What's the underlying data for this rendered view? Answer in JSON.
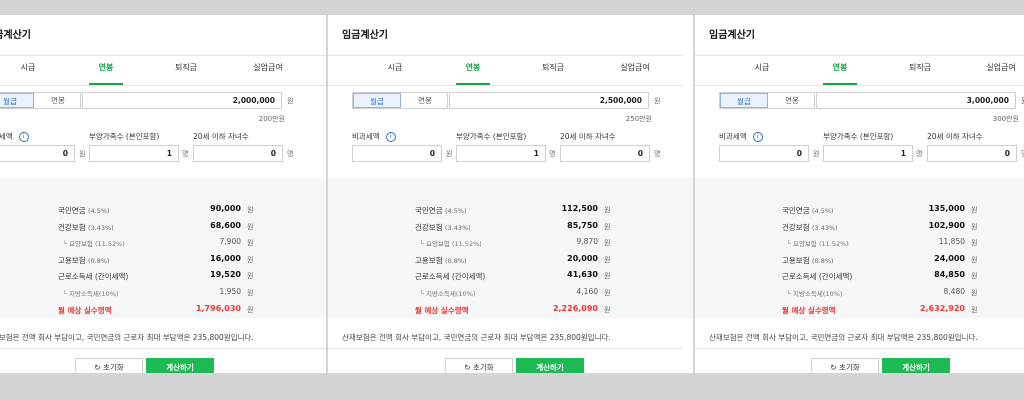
{
  "app": {
    "title": "임금계산기",
    "tabs": [
      "시급",
      "연봉",
      "퇴직금",
      "실업급여"
    ],
    "active_tab": "연봉",
    "toggle": [
      "월급",
      "연봉"
    ],
    "unit_won": "원",
    "unit_person": "명",
    "fields": {
      "nontax_label": "비과세액",
      "dependents_label": "부양가족수 (본인포함)",
      "children_label": "20세 이하 자녀수",
      "nontax_value": "0",
      "dependents_value": "1",
      "children_value": "0"
    },
    "rows": {
      "pension": {
        "label": "국민연금",
        "rate": "(4.5%)"
      },
      "health": {
        "label": "건강보험",
        "rate": "(3.43%)"
      },
      "care": {
        "label": "요양보험",
        "rate": "(11.52%)"
      },
      "employment": {
        "label": "고용보험",
        "rate": "(0.8%)"
      },
      "income_tax": {
        "label": "근로소득세 (간이세액)"
      },
      "local_tax": {
        "label": "지방소득세(10%)"
      },
      "net": {
        "label": "월 예상 실수령액"
      }
    },
    "footnote": "산재보험은 전액 회사 부담이고, 국민연금의 근로자 최대 부담액은 235,800원입니다.",
    "reset_label": "초기화",
    "calc_label": "계산하기",
    "reset_icon": "refresh-icon",
    "info_icon": "info-icon"
  },
  "colors": {
    "accent": "#1aa34a",
    "button": "#1db954",
    "net_red": "#e53935",
    "toggle_blue": "#2a6fc9"
  },
  "panels": [
    {
      "amount": "2,000,000",
      "amount_hint": "200만원",
      "pension": "90,000",
      "health": "68,600",
      "care": "7,900",
      "employment": "16,000",
      "income_tax": "19,520",
      "local_tax": "1,950",
      "net": "1,796,030"
    },
    {
      "amount": "2,500,000",
      "amount_hint": "250만원",
      "pension": "112,500",
      "health": "85,750",
      "care": "9,870",
      "employment": "20,000",
      "income_tax": "41,630",
      "local_tax": "4,160",
      "net": "2,226,090"
    },
    {
      "amount": "3,000,000",
      "amount_hint": "300만원",
      "pension": "135,000",
      "health": "102,900",
      "care": "11,850",
      "employment": "24,000",
      "income_tax": "84,850",
      "local_tax": "8,480",
      "net": "2,632,920"
    }
  ]
}
